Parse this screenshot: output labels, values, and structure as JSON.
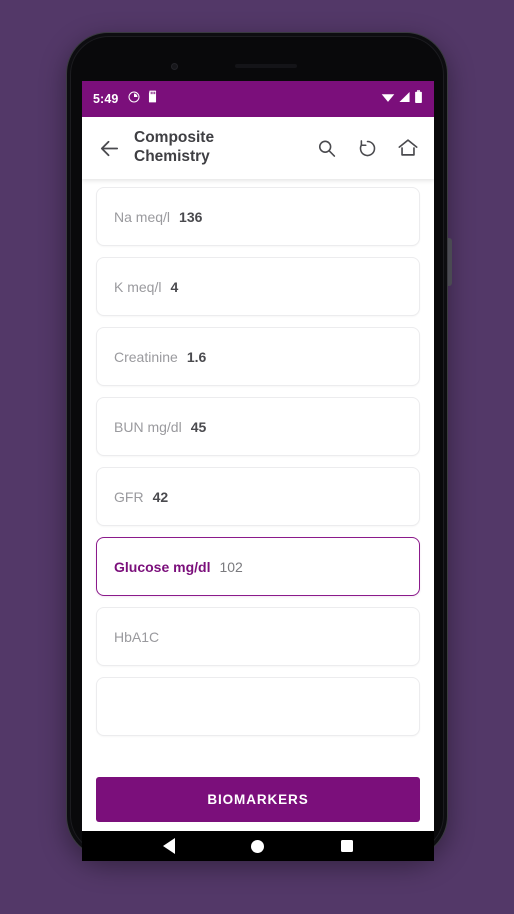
{
  "status_bar": {
    "time": "5:49",
    "left_icons": [
      "alarm-icon",
      "sd-card-icon"
    ],
    "right_icons": [
      "wifi-icon",
      "cell-signal-icon",
      "battery-icon"
    ],
    "background_color": "#7B0F7B"
  },
  "app_bar": {
    "back_icon": "back-arrow-icon",
    "title": "Composite Chemistry",
    "actions": [
      {
        "name": "search-icon",
        "label": "Search"
      },
      {
        "name": "history-icon",
        "label": "History"
      },
      {
        "name": "home-icon",
        "label": "Home"
      }
    ]
  },
  "lab_list": {
    "items": [
      {
        "label": "Na meq/l",
        "value": "136",
        "selected": false
      },
      {
        "label": "K meq/l",
        "value": "4",
        "selected": false
      },
      {
        "label": "Creatinine",
        "value": "1.6",
        "selected": false
      },
      {
        "label": "BUN mg/dl",
        "value": "45",
        "selected": false
      },
      {
        "label": "GFR",
        "value": "42",
        "selected": false
      },
      {
        "label": "Glucose mg/dl",
        "value": "102",
        "selected": true
      },
      {
        "label": "HbA1C",
        "value": "",
        "selected": false
      },
      {
        "label": "",
        "value": "",
        "selected": false
      }
    ]
  },
  "bottom_action": {
    "biomarkers_label": "BIOMARKERS",
    "color": "#7B0F7B"
  },
  "nav_bar": {
    "back": "nav-back-icon",
    "home": "nav-home-icon",
    "recents": "nav-recents-icon"
  },
  "theme": {
    "page_background": "#533868",
    "accent": "#7B0F7B",
    "selected_border": "#8B1A8B",
    "card_border": "#ececee",
    "label_gray": "#9a9a9e",
    "value_gray": "#4a4a4e"
  }
}
